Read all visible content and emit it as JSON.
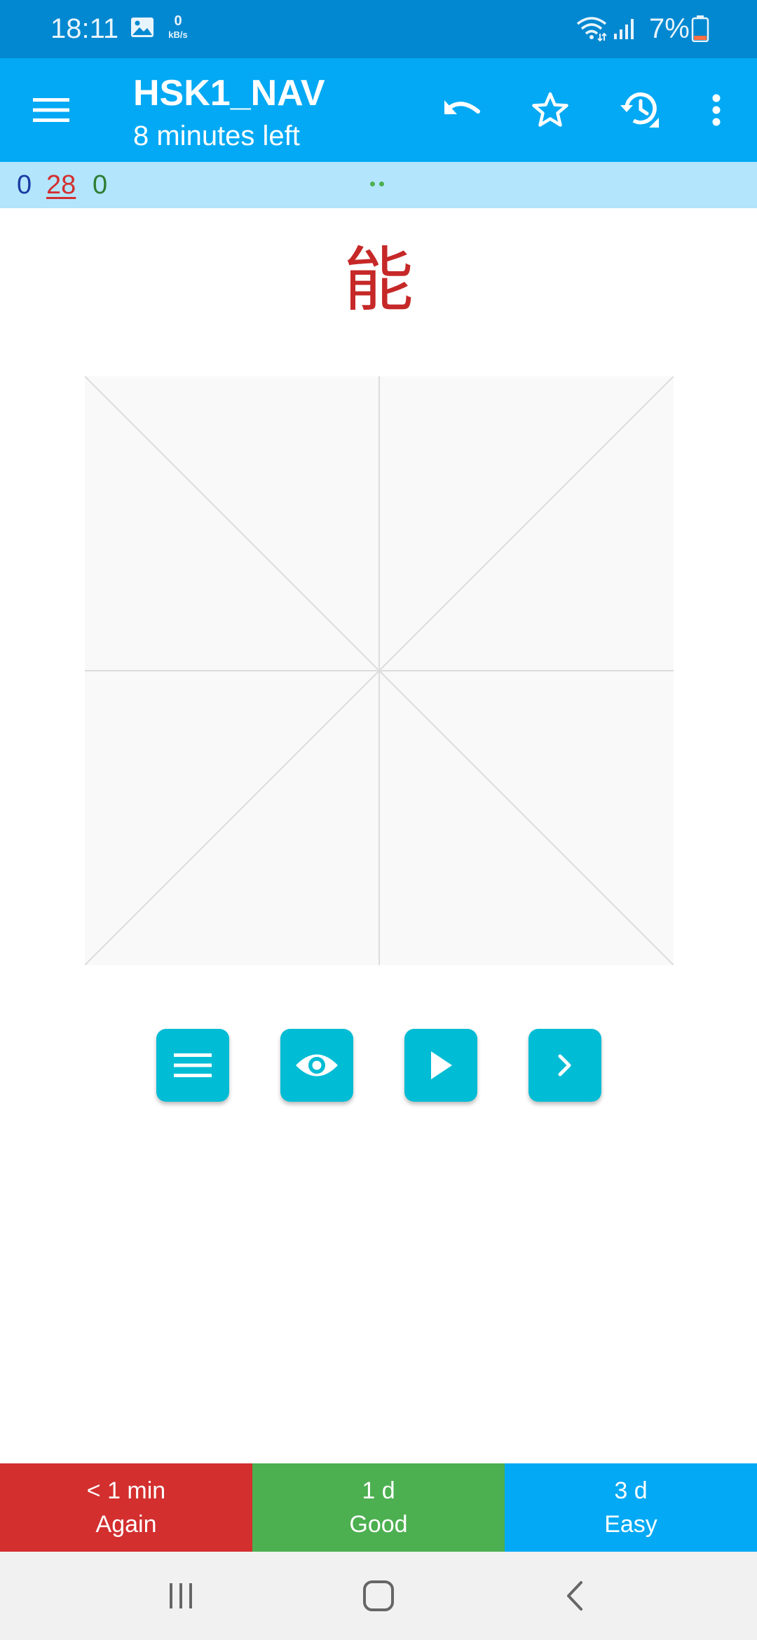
{
  "status_bar": {
    "time": "18:11",
    "net_speed_value": "0",
    "net_speed_unit": "kB/s",
    "battery_percent": "7%",
    "icons": [
      "image-icon",
      "wifi-icon",
      "signal-icon",
      "battery-icon"
    ]
  },
  "app_bar": {
    "title": "HSK1_NAV",
    "subtitle": "8 minutes left",
    "icons": [
      "menu-icon",
      "undo-icon",
      "star-icon",
      "history-icon",
      "more-vert-icon"
    ]
  },
  "counts": {
    "new": "0",
    "learning": "28",
    "review": "0"
  },
  "card": {
    "character": "能"
  },
  "toolbar": {
    "icons": [
      "list-icon",
      "eye-icon",
      "play-icon",
      "chevron-right-icon"
    ]
  },
  "answers": [
    {
      "interval": "< 1 min",
      "label": "Again"
    },
    {
      "interval": "1 d",
      "label": "Good"
    },
    {
      "interval": "3 d",
      "label": "Easy"
    }
  ],
  "colors": {
    "status_bar": "#0288d1",
    "app_bar": "#03a9f4",
    "counts_bar": "#b3e5fc",
    "character": "#c62828",
    "tool_button": "#00bcd4",
    "again": "#d32f2f",
    "good": "#4caf50",
    "easy": "#03a9f4"
  }
}
